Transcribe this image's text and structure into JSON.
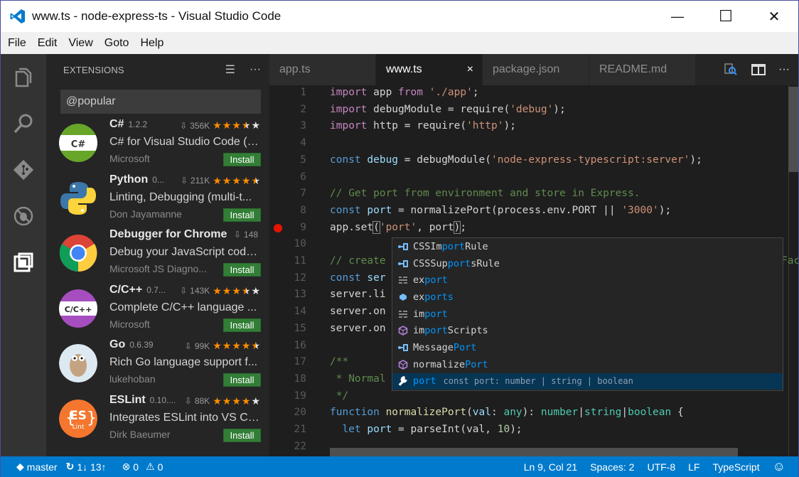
{
  "window": {
    "title": "www.ts - node-express-ts - Visual Studio Code",
    "controls": {
      "minimize": "—",
      "maximize": "☐",
      "close": "✕"
    }
  },
  "menu": [
    "File",
    "Edit",
    "View",
    "Goto",
    "Help"
  ],
  "activity_bar": [
    "explorer-icon",
    "search-icon",
    "git-icon",
    "debug-icon",
    "extensions-icon"
  ],
  "sidebar": {
    "title": "EXTENSIONS",
    "search_value": "@popular",
    "extensions": [
      {
        "name": "C#",
        "version": "1.2.2",
        "downloads": "356K",
        "rating": 3.5,
        "description": "C# for Visual Studio Code (p...",
        "author": "Microsoft",
        "action": "Install",
        "logo": "csharp"
      },
      {
        "name": "Python",
        "version": "0...",
        "downloads": "211K",
        "rating": 4.5,
        "description": "Linting, Debugging (multi-t...",
        "author": "Don Jayamanne",
        "action": "Install",
        "logo": "python"
      },
      {
        "name": "Debugger for Chrome",
        "version": "",
        "downloads": "148",
        "rating": null,
        "description": "Debug your JavaScript code...",
        "author": "Microsoft JS Diagno...",
        "action": "Install",
        "logo": "chrome"
      },
      {
        "name": "C/C++",
        "version": "0.7...",
        "downloads": "143K",
        "rating": 3.5,
        "description": "Complete C/C++ language ...",
        "author": "Microsoft",
        "action": "Install",
        "logo": "cpp"
      },
      {
        "name": "Go",
        "version": "0.6.39",
        "downloads": "99K",
        "rating": 4.5,
        "description": "Rich Go language support f...",
        "author": "lukehoban",
        "action": "Install",
        "logo": "go"
      },
      {
        "name": "ESLint",
        "version": "0.10....",
        "downloads": "88K",
        "rating": 4,
        "description": "Integrates ESLint into VS Co...",
        "author": "Dirk Baeumer",
        "action": "Install",
        "logo": "eslint"
      }
    ]
  },
  "tabs": [
    {
      "label": "app.ts",
      "active": false
    },
    {
      "label": "www.ts",
      "active": true,
      "close": "×"
    },
    {
      "label": "package.json",
      "active": false
    },
    {
      "label": "README.md",
      "active": false
    }
  ],
  "editor": {
    "lines": [
      [
        [
          "kw",
          "import"
        ],
        [
          "",
          "  app "
        ],
        [
          "kw",
          "from"
        ],
        [
          "st",
          " './app'"
        ],
        [
          "",
          ";"
        ]
      ],
      [
        [
          "kw",
          "import"
        ],
        [
          "",
          " debugModule = require("
        ],
        [
          "st",
          "'debug'"
        ],
        [
          "",
          ");"
        ]
      ],
      [
        [
          "kw",
          "import"
        ],
        [
          "",
          " http = require("
        ],
        [
          "st",
          "'http'"
        ],
        [
          "",
          ");"
        ]
      ],
      [],
      [
        [
          "bl",
          "const"
        ],
        [
          "var",
          " debug"
        ],
        [
          "",
          " = debugModule("
        ],
        [
          "st",
          "'node-express-typescript:server'"
        ],
        [
          "",
          ");"
        ]
      ],
      [],
      [
        [
          "cm",
          "// Get port from environment and store in Express."
        ]
      ],
      [
        [
          "bl",
          "const"
        ],
        [
          "var",
          " port"
        ],
        [
          "",
          " = normalizePort(process.env.PORT || "
        ],
        [
          "st",
          "'3000'"
        ],
        [
          "",
          ");"
        ]
      ],
      [
        [
          "",
          "app.set"
        ],
        [
          "bk",
          "("
        ],
        [
          "st",
          "'port'"
        ],
        [
          "",
          ", port"
        ],
        [
          "bk",
          ")"
        ],
        [
          "",
          ";"
        ]
      ],
      [],
      [
        [
          "cm",
          "// create"
        ]
      ],
      [
        [
          "bl",
          "const"
        ],
        [
          "var",
          " ser"
        ]
      ],
      [
        [
          "",
          "server.li"
        ]
      ],
      [
        [
          "",
          "server.on"
        ]
      ],
      [
        [
          "",
          "server.on"
        ]
      ],
      [],
      [
        [
          "cm",
          "/**"
        ]
      ],
      [
        [
          "cm",
          " * Normal"
        ]
      ],
      [
        [
          "cm",
          " */"
        ]
      ],
      [
        [
          "bl",
          "function"
        ],
        [
          "fn",
          " normalizePort"
        ],
        [
          "",
          "("
        ],
        [
          "var",
          "val"
        ],
        [
          "",
          ": "
        ],
        [
          "ty",
          "any"
        ],
        [
          "",
          "): "
        ],
        [
          "ty",
          "number"
        ],
        [
          "",
          "|"
        ],
        [
          "ty",
          "string"
        ],
        [
          "",
          "|"
        ],
        [
          "ty",
          "boolean"
        ],
        [
          "",
          " {"
        ]
      ],
      [
        [
          "",
          ""
        ],
        [
          "bl",
          "  let"
        ],
        [
          "var",
          " port"
        ],
        [
          "",
          " = parseInt(val, "
        ],
        [
          "num",
          "10"
        ],
        [
          "",
          ");"
        ]
      ],
      []
    ],
    "line_11_trailing": "Fac",
    "breakpoint_line": 9
  },
  "suggest": [
    {
      "kind": "class-icon",
      "pre": "CSSIm",
      "match": "port",
      "post": "Rule"
    },
    {
      "kind": "class-icon",
      "pre": "CSSSup",
      "match": "port",
      "post": "sRule"
    },
    {
      "kind": "snippet-icon",
      "pre": "ex",
      "match": "port",
      "post": ""
    },
    {
      "kind": "module-icon",
      "pre": "ex",
      "match": "ports",
      "post": ""
    },
    {
      "kind": "snippet-icon",
      "pre": "im",
      "match": "port",
      "post": ""
    },
    {
      "kind": "function-icon",
      "pre": "im",
      "match": "port",
      "post": "Scripts"
    },
    {
      "kind": "class-icon",
      "pre": "Message",
      "match": "Port",
      "post": ""
    },
    {
      "kind": "function-icon",
      "pre": "normalize",
      "match": "Port",
      "post": ""
    },
    {
      "kind": "variable-icon",
      "pre": "",
      "match": "port",
      "post": "",
      "detail": "const port: number | string | boolean",
      "selected": true
    }
  ],
  "status": {
    "branch": "master",
    "sync": "1↓ 13↑",
    "errors": "0",
    "warnings": "0",
    "position": "Ln 9, Col 21",
    "indent": "Spaces: 2",
    "encoding": "UTF-8",
    "eol": "LF",
    "language": "TypeScript",
    "feedback": "☺"
  },
  "colors": {
    "accent": "#007acc",
    "install": "#327e36",
    "star": "#ff8c00",
    "breakpoint": "#e51400"
  }
}
